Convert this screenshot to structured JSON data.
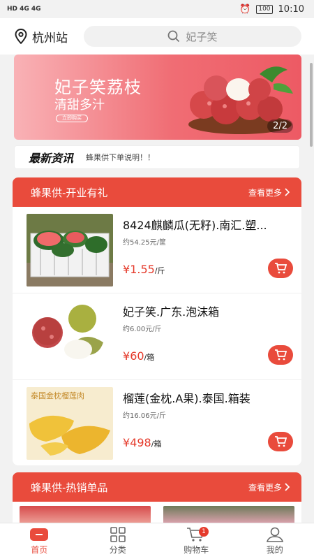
{
  "status": {
    "signal": "HD 4G 4G",
    "battery": "100",
    "time": "10:10"
  },
  "header": {
    "city": "杭州站",
    "search_placeholder": "妃子笑"
  },
  "banner": {
    "title": "妃子笑荔枝",
    "subtitle": "清甜多汁",
    "button": "立即购买",
    "pager": "2/2"
  },
  "news": {
    "tag": "最新资讯",
    "text": "蜂果供下单说明！！"
  },
  "section1": {
    "title": "蜂果供-开业有礼",
    "more": "查看更多",
    "items": [
      {
        "name": "8424麒麟瓜(无籽).南汇.塑...",
        "unit_price": "约54.25元/筐",
        "currency": "¥",
        "price": "1.55",
        "unit": "/斤"
      },
      {
        "name": "妃子笑.广东.泡沫箱",
        "unit_price": "约6.00元/斤",
        "currency": "¥",
        "price": "60",
        "unit": "/箱"
      },
      {
        "name": "榴莲(金枕.A果).泰国.箱装",
        "unit_price": "约16.06元/斤",
        "currency": "¥",
        "price": "498",
        "unit": "/箱"
      }
    ]
  },
  "section2": {
    "title": "蜂果供-热销单品",
    "more": "查看更多"
  },
  "durian_label": "泰国金枕榴莲肉",
  "tabs": [
    {
      "label": "首页",
      "icon": "home-icon"
    },
    {
      "label": "分类",
      "icon": "category-icon"
    },
    {
      "label": "购物车",
      "icon": "cart-icon",
      "badge": "1"
    },
    {
      "label": "我的",
      "icon": "user-icon"
    }
  ],
  "colors": {
    "accent": "#e94b3c",
    "price": "#e53b2c",
    "banner_start": "#f9b2b6",
    "banner_end": "#ed5a64"
  }
}
